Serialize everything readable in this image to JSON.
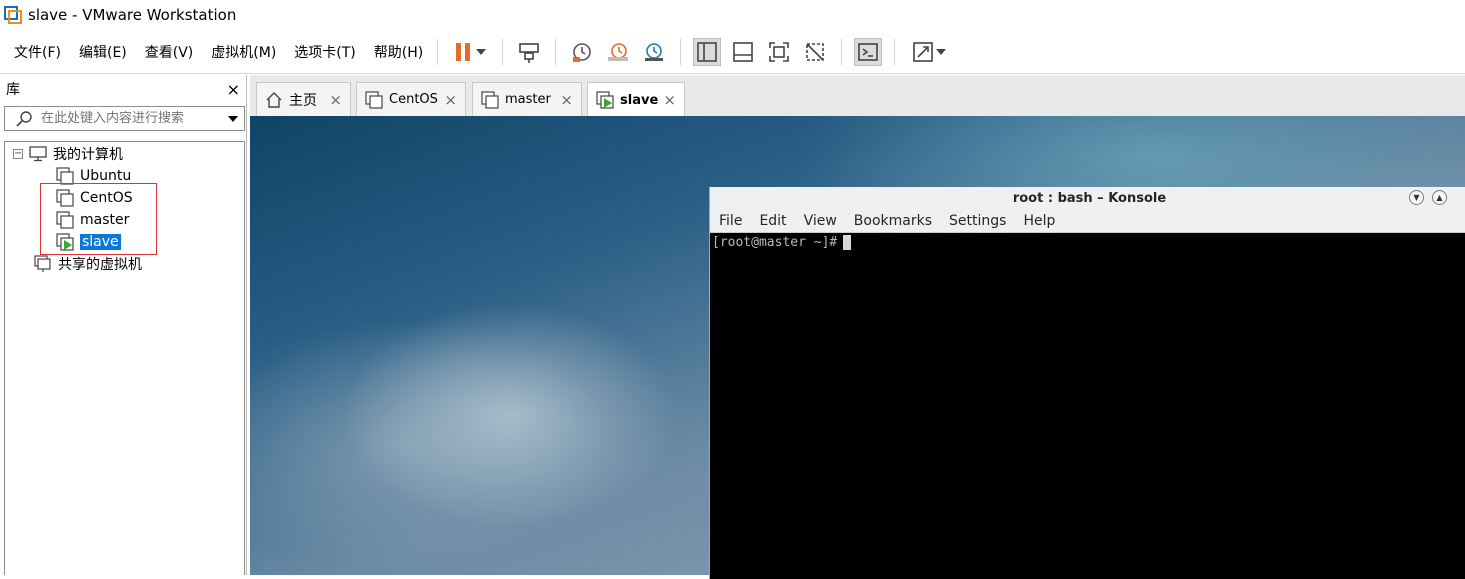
{
  "window": {
    "title": "slave - VMware Workstation"
  },
  "menu": [
    "文件(F)",
    "编辑(E)",
    "查看(V)",
    "虚拟机(M)",
    "选项卡(T)",
    "帮助(H)"
  ],
  "toolbar": {
    "buttons": [
      "pause-icon",
      "send-ctrl-alt-del-icon",
      "snapshot-icon",
      "revert-snapshot-icon",
      "snapshot-manager-icon",
      "show-library-icon",
      "thumbnail-bar-icon",
      "fullscreen-icon",
      "unity-icon",
      "console-view-icon",
      "stretch-icon"
    ],
    "accent_color": "#e8692a"
  },
  "library": {
    "header": "库",
    "close": "×",
    "search_placeholder": "在此处键入内容进行搜索",
    "tree": {
      "root": "我的计算机",
      "vms": [
        "Ubuntu",
        "CentOS",
        "master",
        "slave"
      ],
      "selected": "slave",
      "shared": "共享的虚拟机"
    }
  },
  "tabs": [
    {
      "label": "主页",
      "icon": "home-icon"
    },
    {
      "label": "CentOS",
      "icon": "vm-icon"
    },
    {
      "label": "master",
      "icon": "vm-icon"
    },
    {
      "label": "slave",
      "icon": "vm-running-icon",
      "active": true
    }
  ],
  "tab_close": "×",
  "konsole": {
    "title": "root : bash – Konsole",
    "menu": [
      "File",
      "Edit",
      "View",
      "Bookmarks",
      "Settings",
      "Help"
    ],
    "prompt": "[root@master ~]#"
  },
  "colors": {
    "selection": "#0a78d7",
    "highlight_box": "#e0302f",
    "terminal_bg": "#000000"
  }
}
